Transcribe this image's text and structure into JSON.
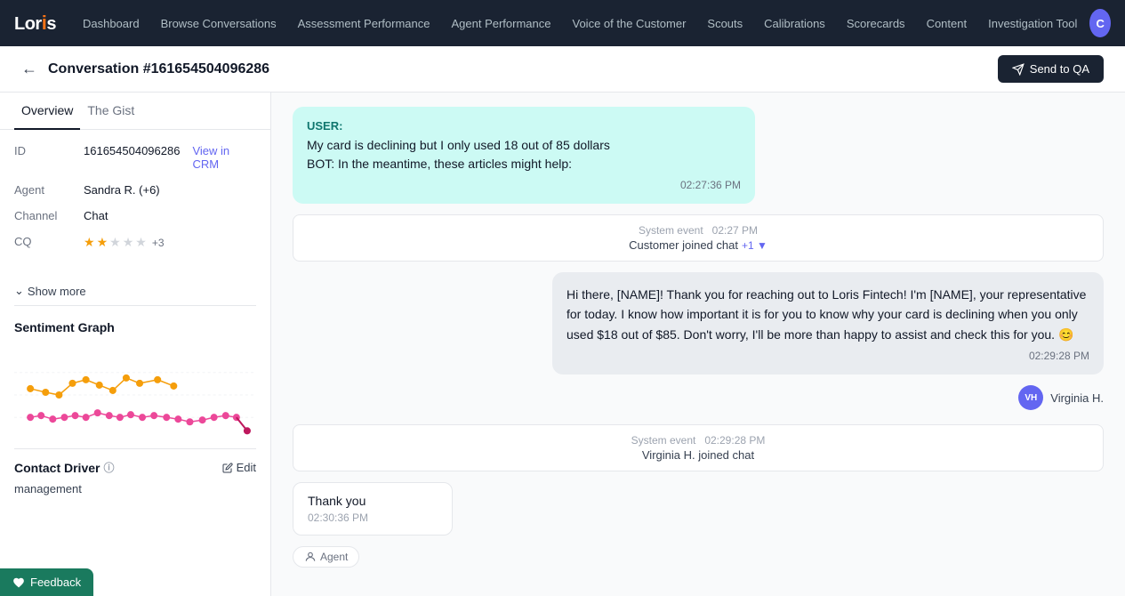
{
  "nav": {
    "logo": "Loris",
    "items": [
      {
        "id": "dashboard",
        "label": "Dashboard"
      },
      {
        "id": "browse-conversations",
        "label": "Browse Conversations"
      },
      {
        "id": "assessment-performance",
        "label": "Assessment Performance"
      },
      {
        "id": "agent-performance",
        "label": "Agent Performance"
      },
      {
        "id": "voice-of-customer",
        "label": "Voice of the Customer"
      },
      {
        "id": "scouts",
        "label": "Scouts"
      },
      {
        "id": "calibrations",
        "label": "Calibrations"
      },
      {
        "id": "scorecards",
        "label": "Scorecards"
      },
      {
        "id": "content",
        "label": "Content"
      },
      {
        "id": "investigation-tool",
        "label": "Investigation Tool"
      }
    ],
    "avatar_initials": "C"
  },
  "header": {
    "conversation_id": "Conversation #161654504096286",
    "send_qa_label": "Send to QA"
  },
  "left_panel": {
    "tabs": [
      {
        "id": "overview",
        "label": "Overview"
      },
      {
        "id": "the-gist",
        "label": "The Gist"
      }
    ],
    "meta": {
      "id_label": "ID",
      "id_value": "161654504096286",
      "view_crm": "View in CRM",
      "agent_label": "Agent",
      "agent_value": "Sandra R. (+6)",
      "channel_label": "Channel",
      "channel_value": "Chat",
      "cq_label": "CQ",
      "cq_stars_filled": 2,
      "cq_stars_total": 5,
      "cq_plus": "+3"
    },
    "show_more_label": "Show more",
    "sentiment_graph_label": "Sentiment Graph",
    "contact_driver_label": "Contact Driver",
    "contact_driver_info": "ⓘ",
    "edit_label": "Edit",
    "contact_driver_value": "management"
  },
  "messages": [
    {
      "type": "user",
      "label": "USER:",
      "lines": [
        "My card is declining but I only used 18 out of 85 dollars",
        "BOT: In the meantime, these articles might help:"
      ],
      "time": "02:27:36 PM"
    },
    {
      "type": "system",
      "event_time": "02:27 PM",
      "text": "Customer joined chat",
      "expand": "+1"
    },
    {
      "type": "agent",
      "text": "Hi there, [NAME]! Thank you for reaching out to Loris Fintech! I'm [NAME], your representative for today. I know how important it is for you to know why your card is declining when you only used $18 out of $85. Don't worry, I'll be more than happy to assist and check this for you. 😊",
      "time": "02:29:28 PM",
      "agent_initials": "VH",
      "agent_name": "Virginia H."
    },
    {
      "type": "system",
      "event_time": "02:29:28 PM",
      "text": "Virginia H. joined chat",
      "expand": ""
    },
    {
      "type": "user-small",
      "text": "Thank you",
      "time": "02:30:36 PM"
    },
    {
      "type": "agent-tag",
      "label": "Agent"
    }
  ],
  "feedback": {
    "label": "Feedback"
  }
}
